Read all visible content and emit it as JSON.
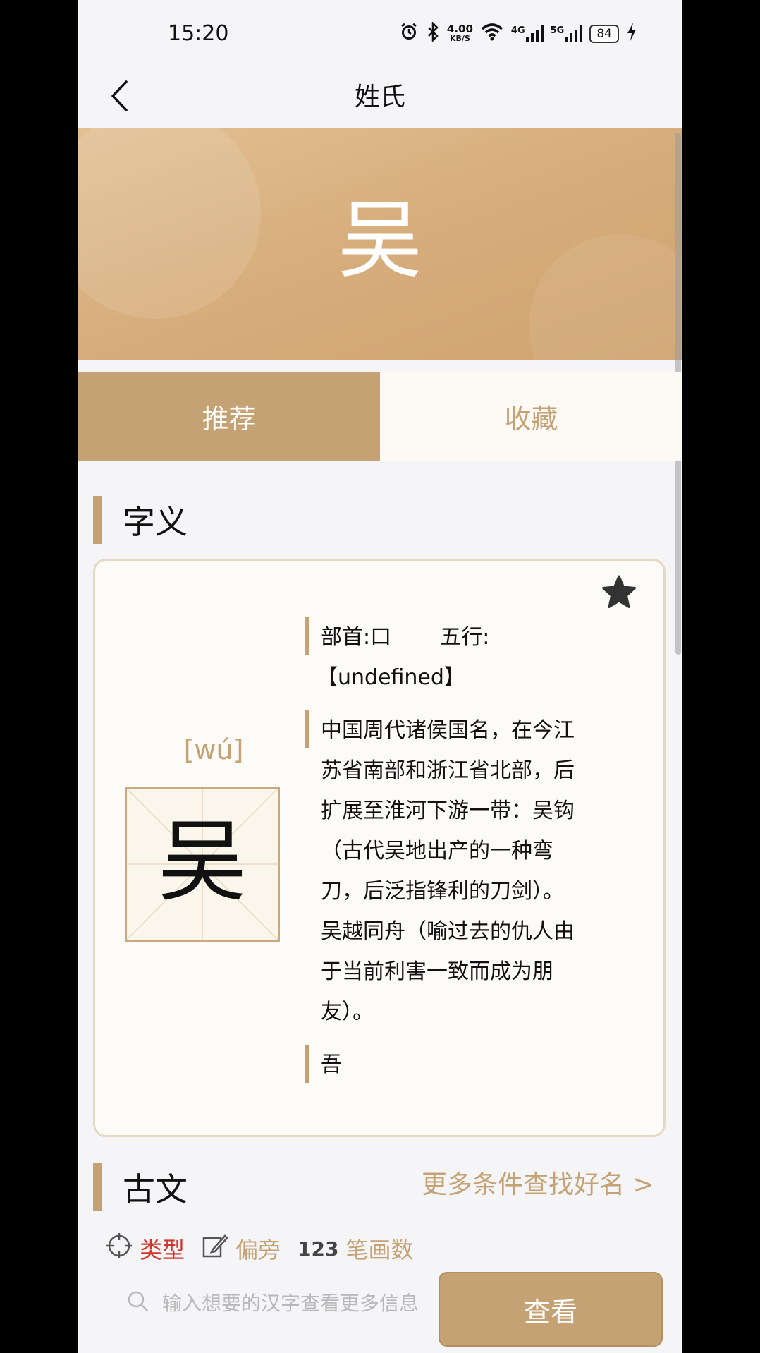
{
  "status_bar": {
    "time": "15:20",
    "net_speed_value": "4.00",
    "net_speed_unit": "KB/S",
    "signal1": "4G",
    "signal2": "5G",
    "battery": "84"
  },
  "nav": {
    "title": "姓氏"
  },
  "hero": {
    "character": "吴"
  },
  "tabs": [
    {
      "label": "推荐",
      "active": true
    },
    {
      "label": "收藏",
      "active": false
    }
  ],
  "meaning_section": {
    "title": "字义",
    "pinyin": "[wú]",
    "character": "吴",
    "radical": "部首:口",
    "five_elements": "五行:",
    "five_elements_value": "【undefined】",
    "definition_lines": [
      "中国周代诸侯国名，在今江",
      "苏省南部和浙江省北部，后",
      "扩展至淮河下游一带：吴钩",
      "（古代吴地出产的一种弯",
      "刀，后泛指锋利的刀剑）。",
      "吴越同舟（喻过去的仇人由",
      "于当前利害一致而成为朋",
      "友）。"
    ],
    "variant": "吾"
  },
  "classics_section": {
    "title": "古文",
    "more_link": "更多条件查找好名 >",
    "filters": [
      {
        "label": "类型",
        "color": "#d0352c"
      },
      {
        "label": "偏旁",
        "color": "#c4a274"
      },
      {
        "label": "笔画数",
        "color": "#c4a274"
      }
    ],
    "stroke_prefix": "123"
  },
  "bottom": {
    "search_placeholder": "输入想要的汉字查看更多信息",
    "search_value": "",
    "view_button": "查看"
  }
}
